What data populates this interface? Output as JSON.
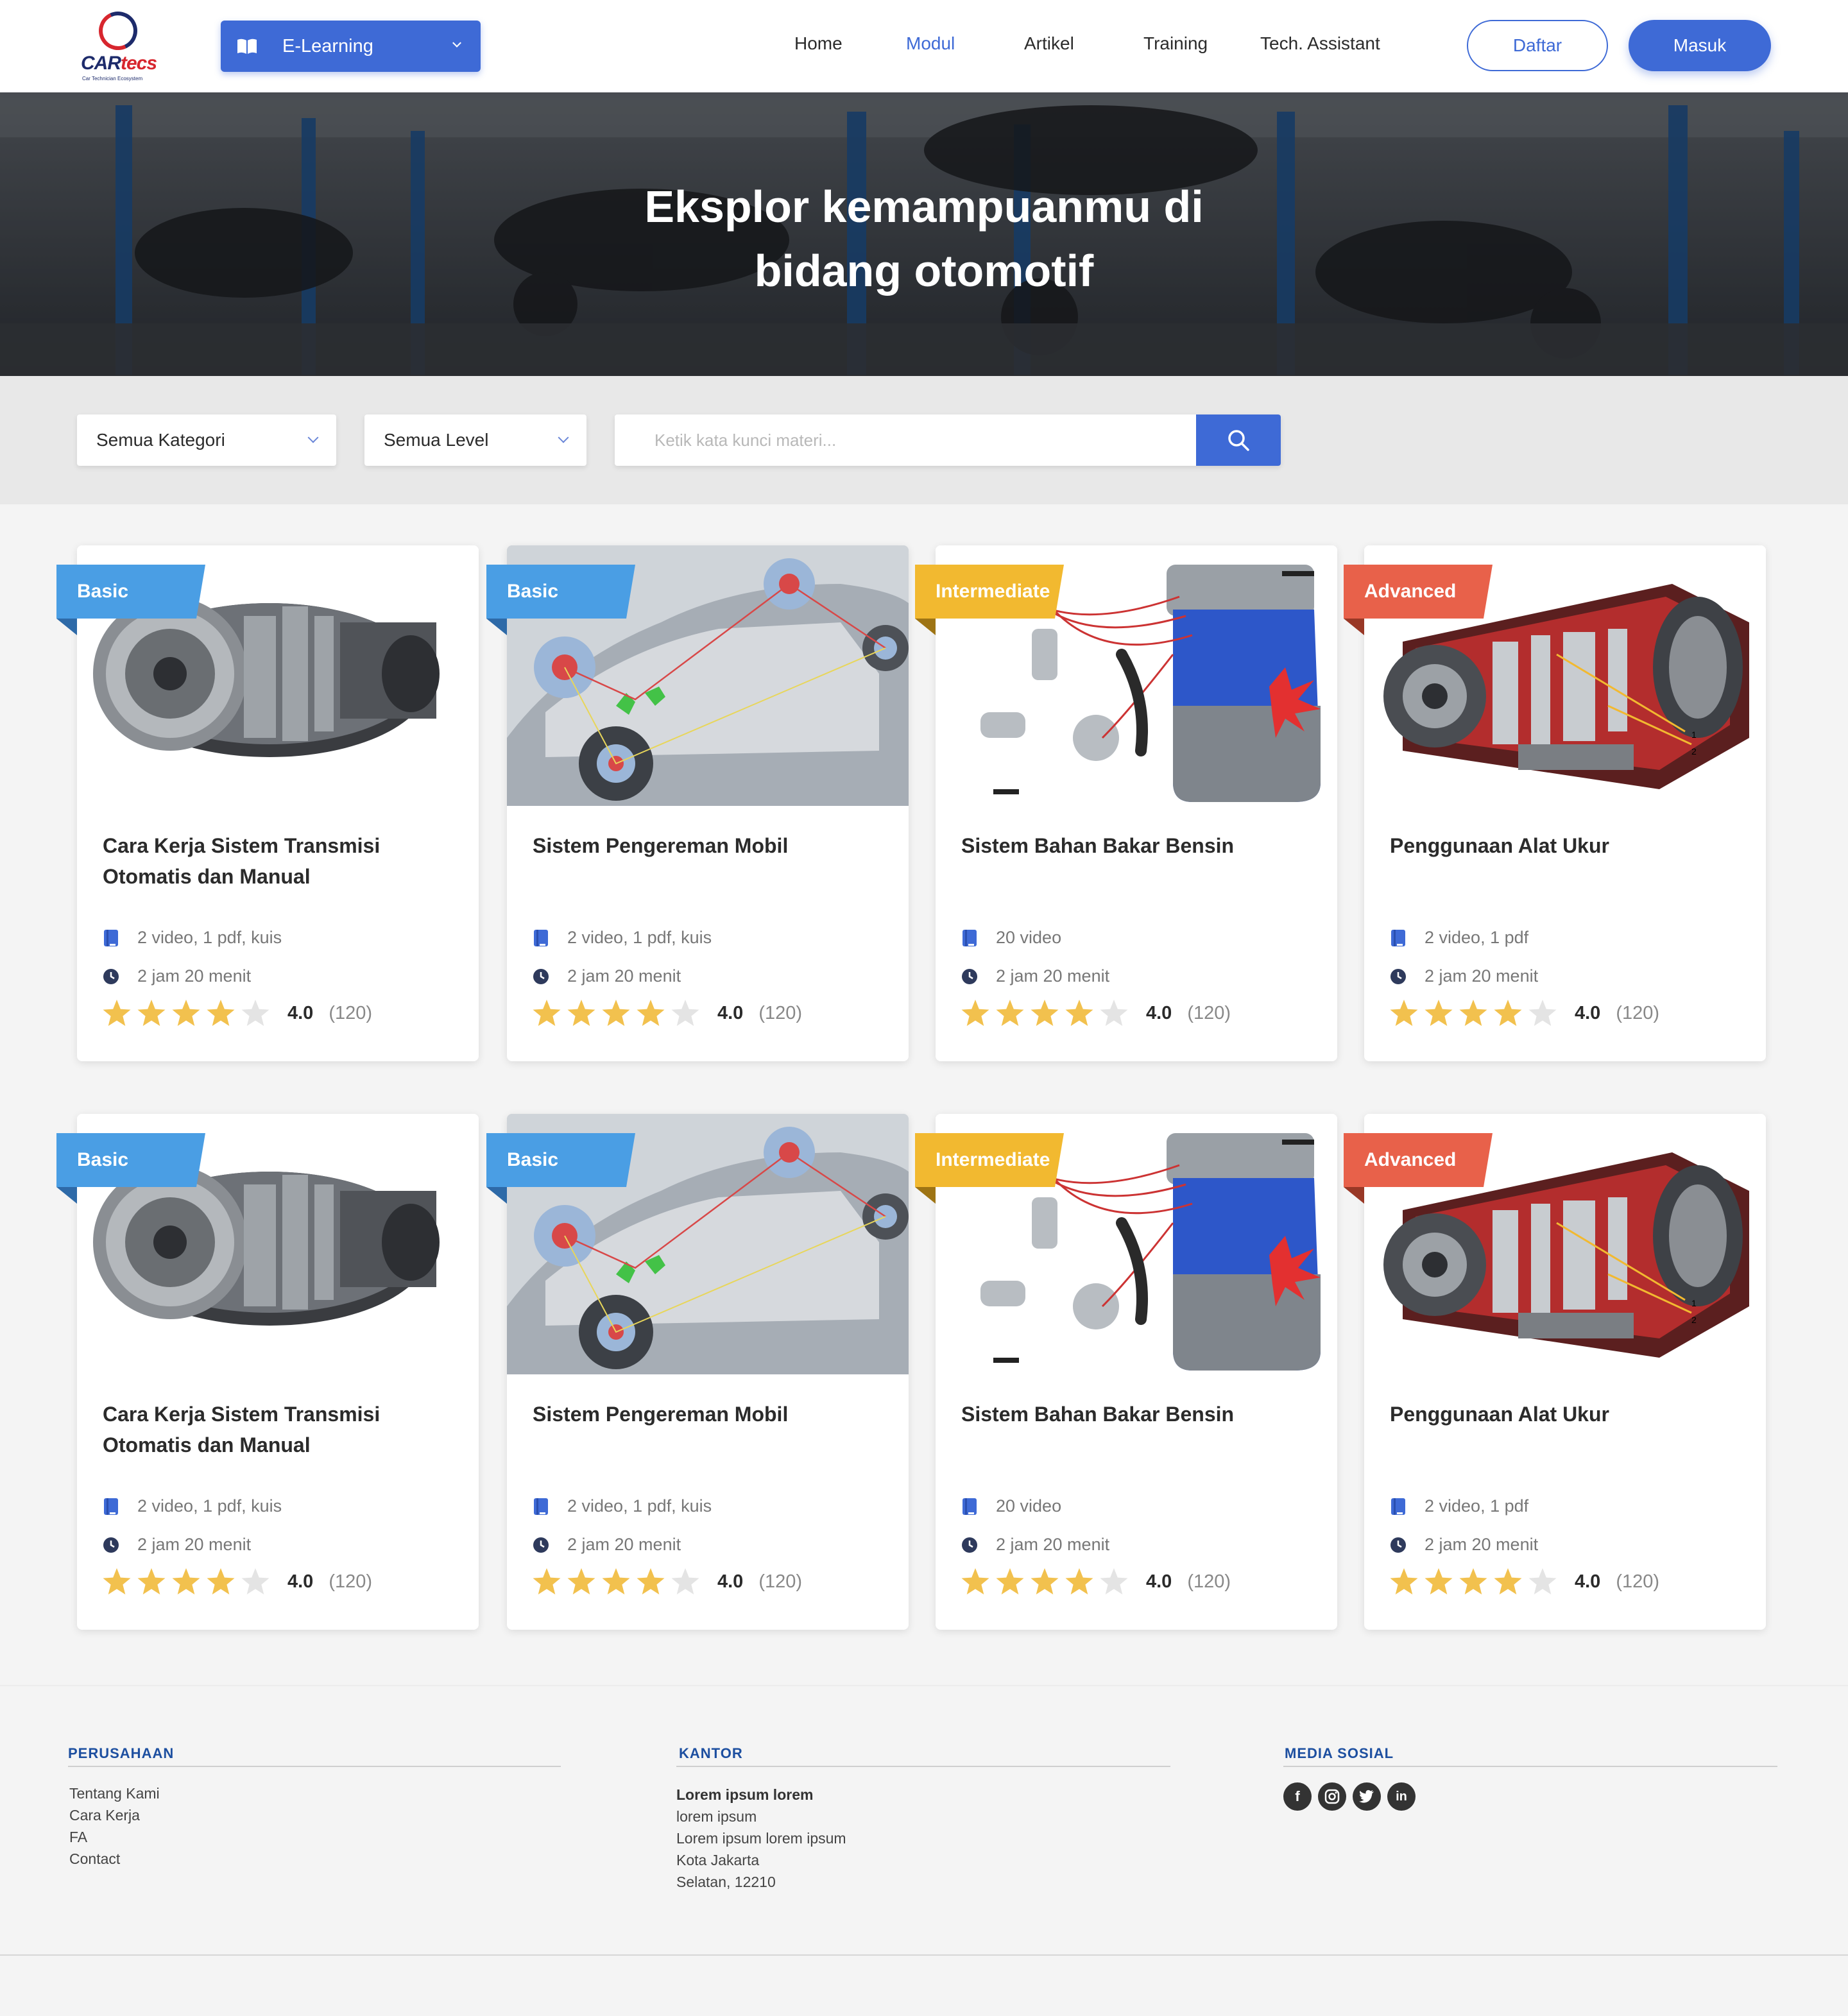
{
  "nav": {
    "logo_text": "CARtecs",
    "logo_tagline": "Car Technician Ecosystem",
    "dropdown_label": "E-Learning",
    "links": [
      "Home",
      "Modul",
      "Artikel",
      "Training",
      "Tech. Assistant"
    ],
    "active_link": "Modul",
    "register_label": "Daftar",
    "login_label": "Masuk"
  },
  "hero": {
    "title_line1": "Eksplor kemampuanmu di",
    "title_line2": "bidang otomotif"
  },
  "filters": {
    "category": "Semua Kategori",
    "level": "Semua Level",
    "search_placeholder": "Ketik kata kunci materi..."
  },
  "cards": [
    {
      "level": "Basic",
      "title": "Cara Kerja Sistem Transmisi Otomatis dan Manual",
      "content": "2 video, 1 pdf, kuis",
      "duration": "2 jam 20 menit",
      "rating": "4.0",
      "reviews": "(120)",
      "stars_filled": 4,
      "image": "transmission"
    },
    {
      "level": "Basic",
      "title": "Sistem Pengereman Mobil",
      "content": "2 video, 1 pdf, kuis",
      "duration": "2 jam 20 menit",
      "rating": "4.0",
      "reviews": "(120)",
      "stars_filled": 4,
      "image": "brake-system"
    },
    {
      "level": "Intermediate",
      "title": "Sistem Bahan Bakar Bensin",
      "content": "20 video",
      "duration": "2 jam 20 menit",
      "rating": "4.0",
      "reviews": "(120)",
      "stars_filled": 4,
      "image": "fuel-system"
    },
    {
      "level": "Advanced",
      "title": "Penggunaan Alat Ukur",
      "content": "2 video, 1 pdf",
      "duration": "2 jam 20 menit",
      "rating": "4.0",
      "reviews": "(120)",
      "stars_filled": 4,
      "image": "cutaway-transmission"
    },
    {
      "level": "Basic",
      "title": "Cara Kerja Sistem Transmisi Otomatis dan Manual",
      "content": "2 video, 1 pdf, kuis",
      "duration": "2 jam 20 menit",
      "rating": "4.0",
      "reviews": "(120)",
      "stars_filled": 4,
      "image": "transmission"
    },
    {
      "level": "Basic",
      "title": "Sistem Pengereman Mobil",
      "content": "2 video, 1 pdf, kuis",
      "duration": "2 jam 20 menit",
      "rating": "4.0",
      "reviews": "(120)",
      "stars_filled": 4,
      "image": "brake-system"
    },
    {
      "level": "Intermediate",
      "title": "Sistem Bahan Bakar Bensin",
      "content": "20 video",
      "duration": "2 jam 20 menit",
      "rating": "4.0",
      "reviews": "(120)",
      "stars_filled": 4,
      "image": "fuel-system"
    },
    {
      "level": "Advanced",
      "title": "Penggunaan Alat Ukur",
      "content": "2 video, 1 pdf",
      "duration": "2 jam 20 menit",
      "rating": "4.0",
      "reviews": "(120)",
      "stars_filled": 4,
      "image": "cutaway-transmission"
    }
  ],
  "footer": {
    "company_heading": "PERUSAHAAN",
    "company_links": [
      "Tentang Kami",
      "Cara Kerja",
      "FA",
      "Contact"
    ],
    "office_heading": "KANTOR",
    "office_name": "Lorem ipsum lorem",
    "office_lines": [
      "lorem ipsum",
      "Lorem ipsum lorem ipsum",
      "Kota Jakarta",
      "Selatan, 12210"
    ],
    "social_heading": "MEDIA SOSIAL",
    "social": [
      "facebook-icon",
      "instagram-icon",
      "twitter-icon",
      "linkedin-icon"
    ]
  },
  "colors": {
    "primary": "#3e6ad6",
    "basic": "#4a9ee4",
    "intermediate": "#f2b930",
    "advanced": "#e8614a",
    "star": "#f2c14e",
    "star_empty": "#e4e4e4"
  }
}
